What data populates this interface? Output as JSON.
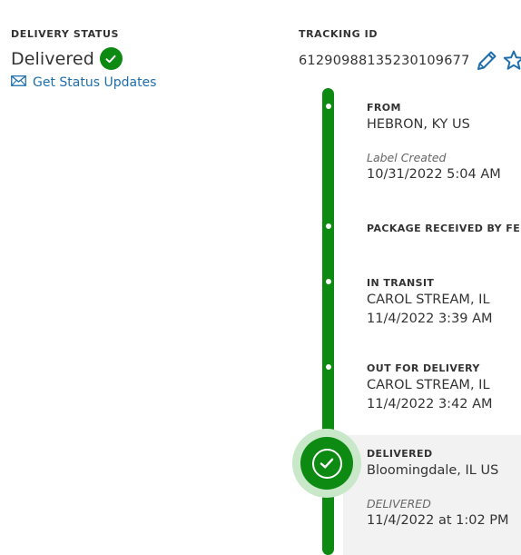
{
  "delivery_status": {
    "label": "DELIVERY STATUS",
    "value": "Delivered",
    "updates_link": "Get Status Updates"
  },
  "tracking": {
    "label": "TRACKING ID",
    "number": "612909881352301096 77"
  },
  "timeline": {
    "from": {
      "title": "FROM",
      "location": "HEBRON, KY US",
      "note": "Label Created",
      "datetime": "10/31/2022 5:04 AM"
    },
    "received": {
      "title": "PACKAGE RECEIVED BY FEDEX"
    },
    "in_transit": {
      "title": "IN TRANSIT",
      "location": "CAROL STREAM, IL",
      "datetime": "11/4/2022 3:39 AM"
    },
    "out_for_delivery": {
      "title": "OUT FOR DELIVERY",
      "location": "CAROL STREAM, IL",
      "datetime": "11/4/2022 3:42 AM"
    },
    "delivered": {
      "title": "DELIVERED",
      "location": "Bloomingdale, IL US",
      "note": "DELIVERED",
      "datetime": "11/4/2022 at 1:02 PM"
    }
  },
  "icons": {
    "status": "check-circle-icon",
    "updates": "envelope-icon",
    "edit": "pencil-icon",
    "favorite": "star-icon",
    "delivered": "check-circle-icon"
  },
  "colors": {
    "brand_green": "#0d8a12",
    "link_blue": "#1f6fad",
    "halo_green": "#c9e7c9",
    "highlight_bg": "#f2f2f2"
  }
}
